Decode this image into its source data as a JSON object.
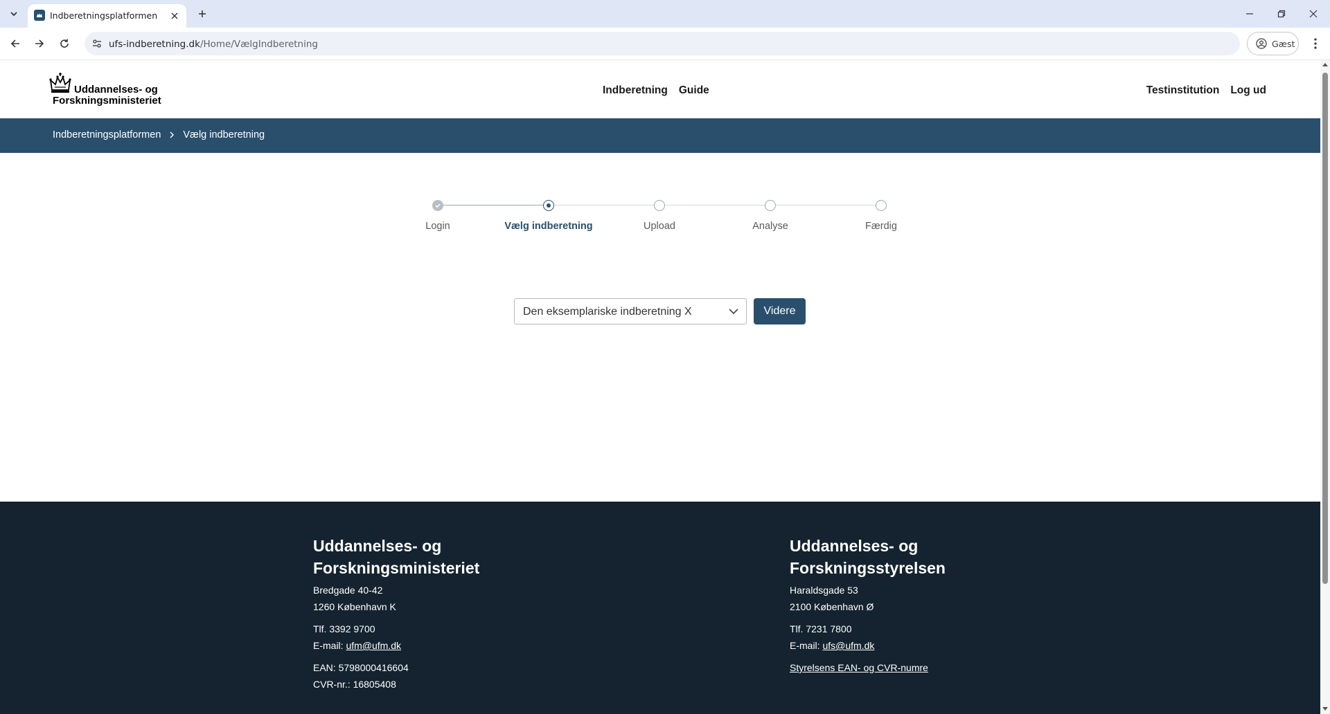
{
  "browser": {
    "tab_title": "Indberetningsplatformen",
    "url_domain": "ufs-indberetning.dk",
    "url_path": "/Home/VælgIndberetning",
    "profile_label": "Gæst"
  },
  "header": {
    "logo_line1": "Uddannelses- og",
    "logo_line2": "Forskningsministeriet",
    "nav": {
      "indberetning": "Indberetning",
      "guide": "Guide"
    },
    "user": {
      "institution": "Testinstitution",
      "logout": "Log ud"
    }
  },
  "breadcrumb": {
    "home": "Indberetningsplatformen",
    "current": "Vælg indberetning"
  },
  "stepper": {
    "steps": [
      {
        "label": "Login",
        "state": "done"
      },
      {
        "label": "Vælg indberetning",
        "state": "active"
      },
      {
        "label": "Upload",
        "state": "todo"
      },
      {
        "label": "Analyse",
        "state": "todo"
      },
      {
        "label": "Færdig",
        "state": "todo"
      }
    ]
  },
  "form": {
    "select_value": "Den eksemplariske indberetning X",
    "next_label": "Videre"
  },
  "footer": {
    "left": {
      "title_line1": "Uddannelses- og",
      "title_line2": "Forskningsministeriet",
      "address1": "Bredgade 40-42",
      "address2": "1260 København K",
      "phone": "Tlf. 3392 9700",
      "email_prefix": "E-mail: ",
      "email": "ufm@ufm.dk",
      "ean": "EAN: 5798000416604",
      "cvr": "CVR-nr.: 16805408"
    },
    "right": {
      "title_line1": "Uddannelses- og",
      "title_line2": "Forskningsstyrelsen",
      "address1": "Haraldsgade 53",
      "address2": "2100 København Ø",
      "phone": "Tlf. 7231 7800",
      "email_prefix": "E-mail: ",
      "email": "ufs@ufm.dk",
      "link": "Styrelsens EAN- og CVR-numre"
    }
  },
  "colors": {
    "brand": "#2a4f6d",
    "footer_bg": "#14232f"
  }
}
